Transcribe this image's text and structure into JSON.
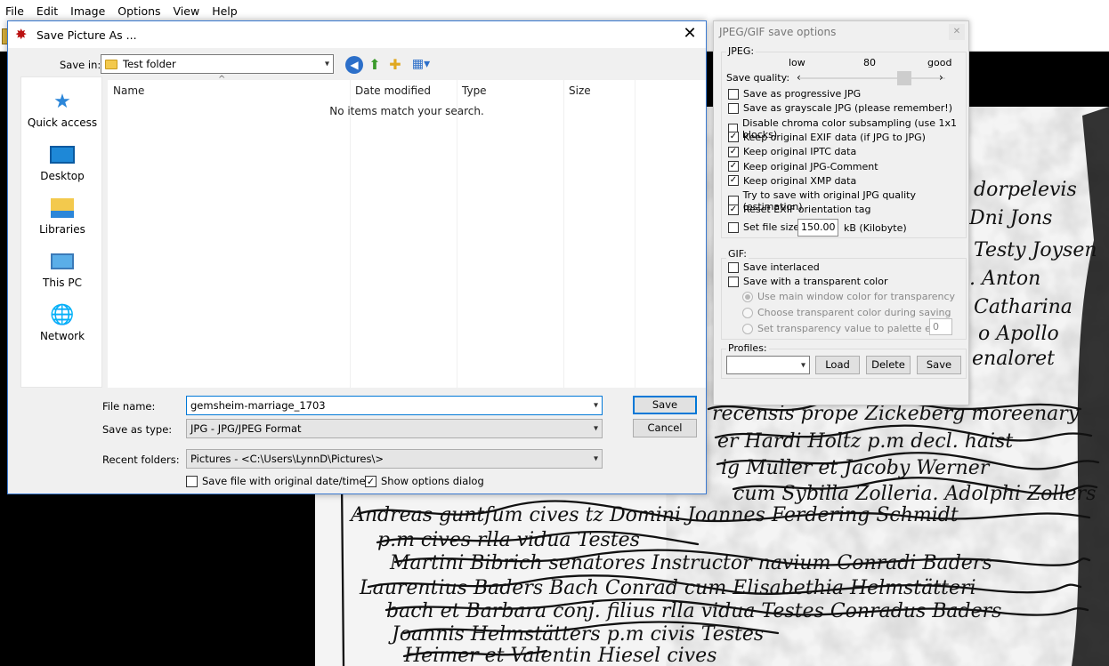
{
  "app": {
    "menu": [
      "File",
      "Edit",
      "Image",
      "Options",
      "View",
      "Help"
    ]
  },
  "dialog": {
    "title": "Save Picture As ...",
    "save_in_label": "Save in:",
    "save_in_value": "Test folder",
    "places": [
      "Quick access",
      "Desktop",
      "Libraries",
      "This PC",
      "Network"
    ],
    "columns": [
      "Name",
      "Date modified",
      "Type",
      "Size"
    ],
    "empty_message": "No items match your search.",
    "file_name_label": "File name:",
    "file_name_value": "gemsheim-marriage_1703",
    "save_type_label": "Save as type:",
    "save_type_value": "JPG - JPG/JPEG Format",
    "recent_label": "Recent folders:",
    "recent_value": "Pictures  -  <C:\\Users\\LynnD\\Pictures\\>",
    "save_button": "Save",
    "cancel_button": "Cancel",
    "keep_date_label": "Save file with original date/time",
    "keep_date_checked": false,
    "show_options_label": "Show options dialog",
    "show_options_checked": true
  },
  "options": {
    "title": "JPEG/GIF save options",
    "jpeg_group": "JPEG:",
    "quality_low": "low",
    "quality_value": "80",
    "quality_good": "good",
    "quality_label": "Save quality:",
    "quality_level_percent": 80,
    "jpeg_checks": [
      {
        "label": "Save as progressive JPG",
        "checked": false
      },
      {
        "label": "Save as grayscale JPG (please remember!)",
        "checked": false
      },
      {
        "label": "Disable chroma color subsampling (use 1x1 blocks)",
        "checked": false
      },
      {
        "label": "Keep original EXIF data (if JPG to JPG)",
        "checked": true
      },
      {
        "label": "Keep original IPTC data",
        "checked": true
      },
      {
        "label": "Keep original JPG-Comment",
        "checked": true
      },
      {
        "label": "Keep original XMP data",
        "checked": true
      },
      {
        "label": "Try to save with original JPG quality (estimation)",
        "checked": false
      },
      {
        "label": "Reset EXIF orientation tag",
        "checked": true
      }
    ],
    "file_size_label": "Set file size:",
    "file_size_checked": false,
    "file_size_value": "150.00",
    "file_size_unit": "kB (Kilobyte)",
    "gif_group": "GIF:",
    "gif_interlaced": "Save interlaced",
    "gif_transparent": "Save with a transparent color",
    "radio_main": "Use main window color for transparency",
    "radio_choose": "Choose transparent color during saving",
    "radio_palette": "Set transparency value to palette entry:",
    "palette_value": "0",
    "profiles_group": "Profiles:",
    "load_button": "Load",
    "delete_button": "Delete",
    "save_button": "Save"
  }
}
